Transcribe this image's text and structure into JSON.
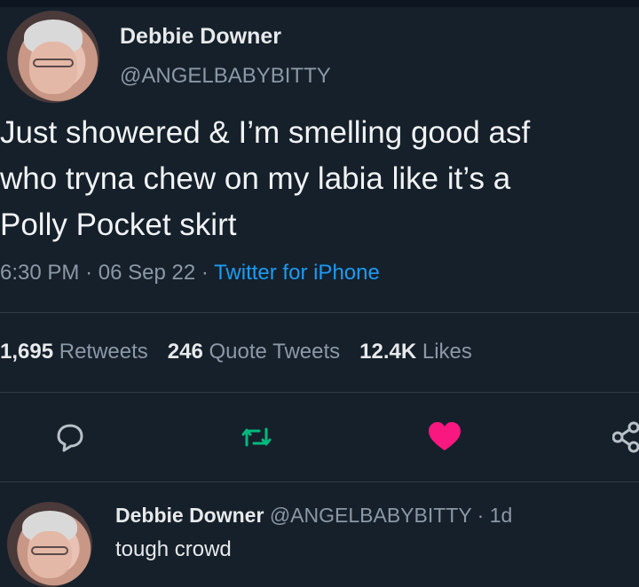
{
  "tweet": {
    "display_name": "Debbie Downer",
    "handle": "@ANGELBABYBITTY",
    "text_lines": [
      "Just showered & I’m smelling good asf",
      "who tryna chew on my labia like it’s a",
      "Polly Pocket skirt"
    ],
    "time": "6:30 PM",
    "date": "06 Sep 22",
    "source": "Twitter for iPhone",
    "separator": "·"
  },
  "stats": {
    "retweets_count": "1,695",
    "retweets_label": "Retweets",
    "quotes_count": "246",
    "quotes_label": "Quote Tweets",
    "likes_count": "12.4K",
    "likes_label": "Likes"
  },
  "actions": {
    "reply_icon": "reply-icon",
    "retweet_icon": "retweet-icon",
    "like_icon": "heart-icon",
    "share_icon": "share-icon",
    "retweet_color": "#00ba7c",
    "like_color": "#f91880"
  },
  "reply": {
    "display_name": "Debbie Downer",
    "handle": "@ANGELBABYBITTY",
    "separator": "·",
    "age": "1d",
    "text": "tough crowd"
  },
  "colors": {
    "background": "#15202b",
    "secondary_text": "#8b98a5",
    "link": "#1d9bf0"
  }
}
